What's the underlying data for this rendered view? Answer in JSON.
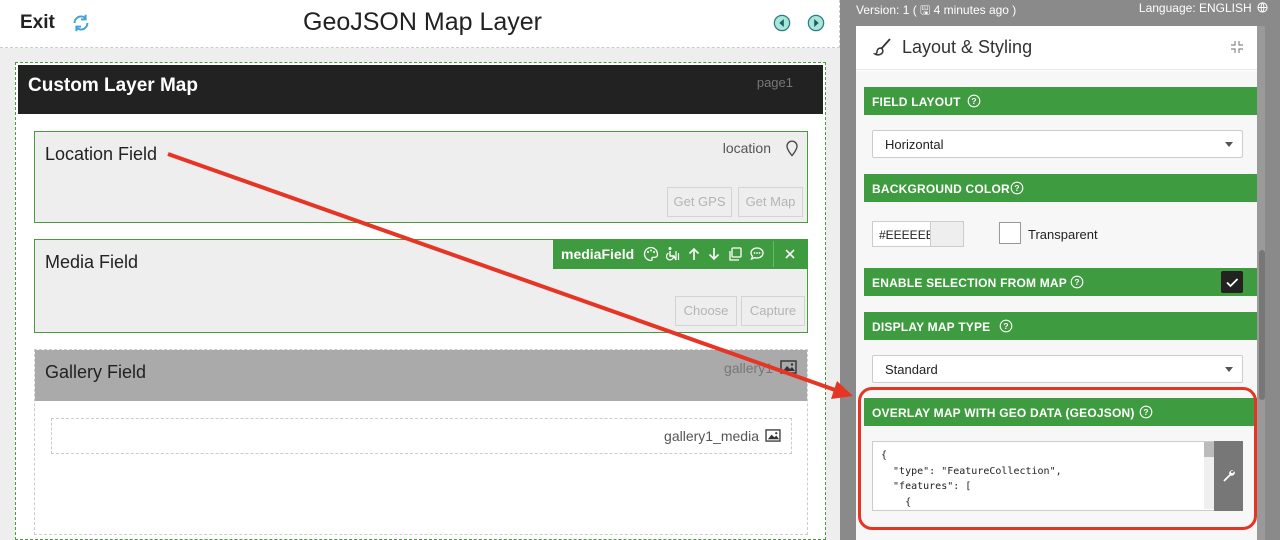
{
  "header": {
    "exit_label": "Exit",
    "title": "GeoJSON Map Layer"
  },
  "page": {
    "title": "Custom Layer Map",
    "id": "page1",
    "fields": [
      {
        "title": "Location Field",
        "id": "location",
        "buttons": [
          "Get GPS",
          "Get Map"
        ]
      },
      {
        "title": "Media Field",
        "toolbar_label": "mediaField",
        "buttons": [
          "Choose",
          "Capture"
        ]
      },
      {
        "title": "Gallery Field",
        "id": "gallery1",
        "sub_id": "gallery1_media"
      }
    ]
  },
  "right_panel": {
    "version": "Version: 1 ( 🖫 4 minutes ago )",
    "language": "Language: ENGLISH",
    "panel_title": "Layout & Styling",
    "sections": {
      "field_layout": {
        "label": "FIELD LAYOUT",
        "value": "Horizontal"
      },
      "background_color": {
        "label": "BACKGROUND COLOR",
        "value": "#EEEEEE",
        "transparent_label": "Transparent",
        "transparent_checked": false
      },
      "enable_selection": {
        "label": "ENABLE SELECTION FROM MAP",
        "checked": true
      },
      "display_map_type": {
        "label": "DISPLAY MAP TYPE",
        "value": "Standard"
      },
      "overlay_geojson": {
        "label": "OVERLAY MAP WITH GEO DATA (GEOJSON)",
        "value": "{\n  \"type\": \"FeatureCollection\",\n  \"features\": [\n    {"
      }
    }
  },
  "colors": {
    "accent_green": "#3f9b3f",
    "header_dark": "#222222",
    "highlight_red": "#e53525"
  }
}
